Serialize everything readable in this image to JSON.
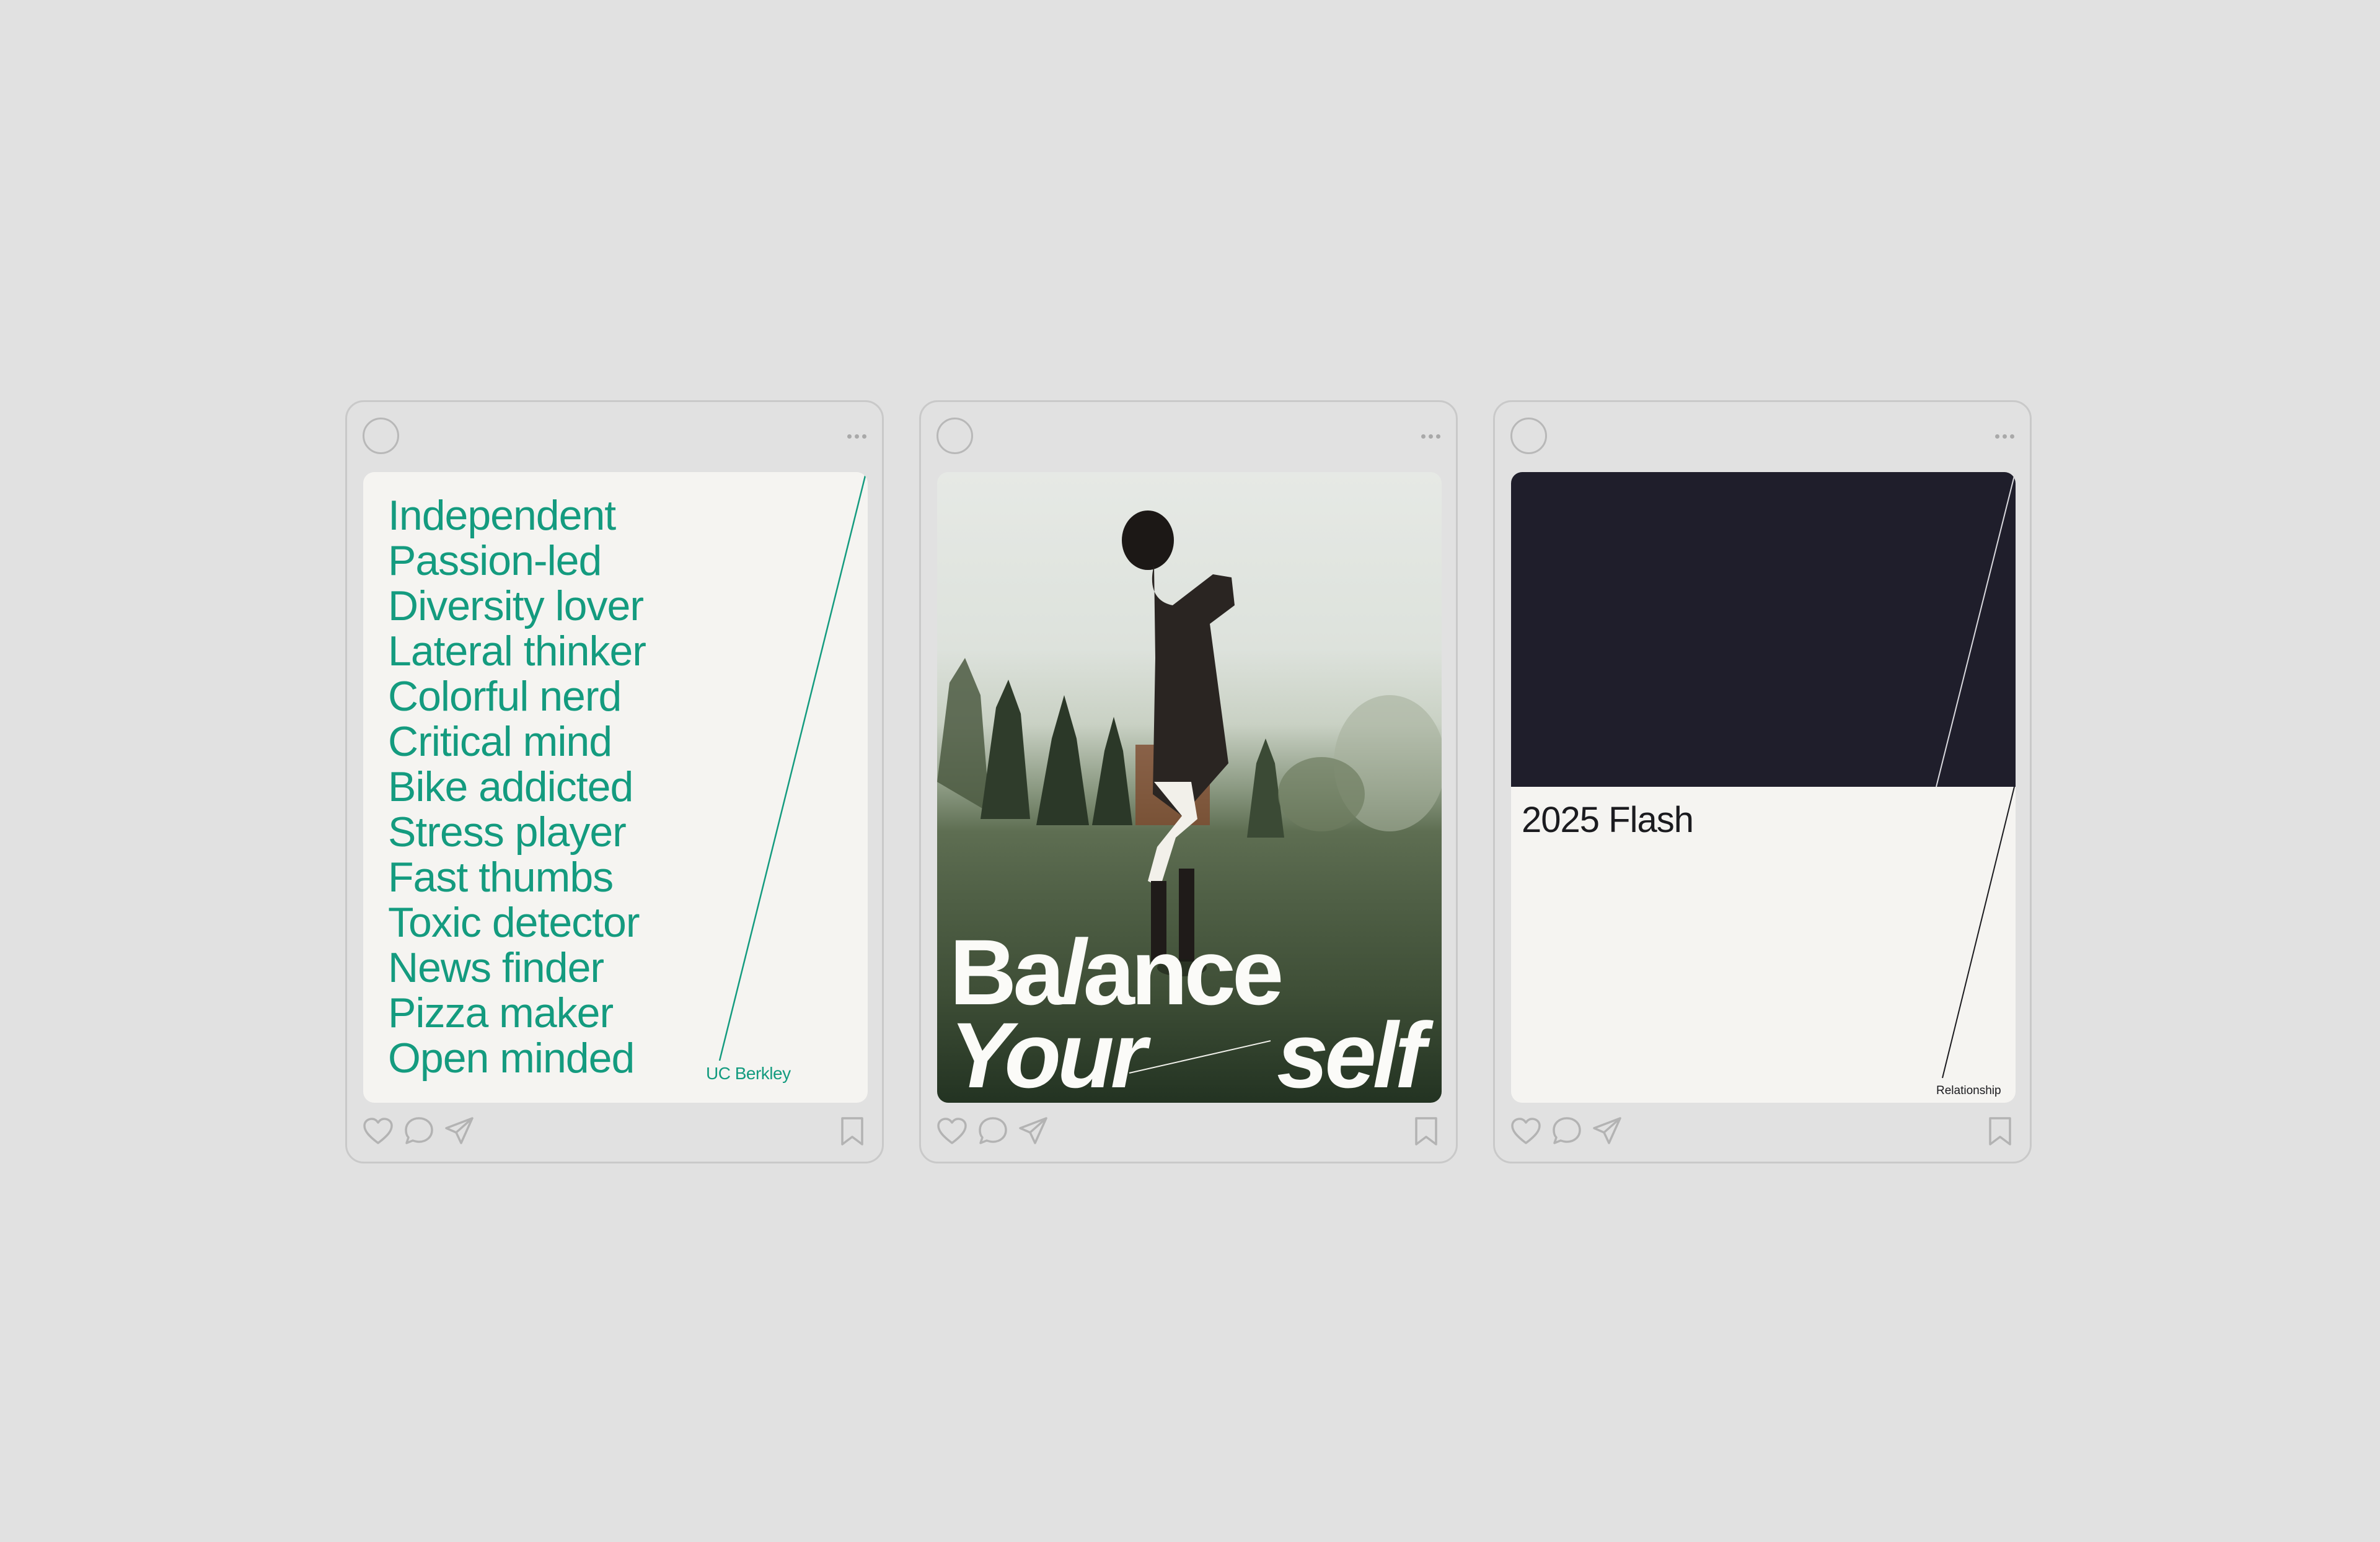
{
  "posts": [
    {
      "words": [
        "Independent",
        "Passion-led",
        "Diversity lover",
        "Lateral thinker",
        "Colorful nerd",
        "Critical mind",
        "Bike addicted",
        "Stress player",
        "Fast thumbs",
        "Toxic detector",
        "News finder",
        "Pizza maker",
        "Open minded"
      ],
      "caption": "UC Berkley"
    },
    {
      "title_line1_a": "Ba",
      "title_line1_b": "l",
      "title_line1_c": "ance",
      "title_line2": "Your",
      "title_line3": "self"
    },
    {
      "title": "2025 Flash",
      "caption": "Relationship"
    }
  ],
  "icons": [
    "heart-icon",
    "comment-icon",
    "share-icon",
    "bookmark-icon",
    "more-dots-icon"
  ],
  "colors": {
    "accent_green": "#149b7f",
    "dark_block": "#1f1e2b",
    "card_bg": "#f5f4f1",
    "page_bg": "#e1e1e1"
  }
}
